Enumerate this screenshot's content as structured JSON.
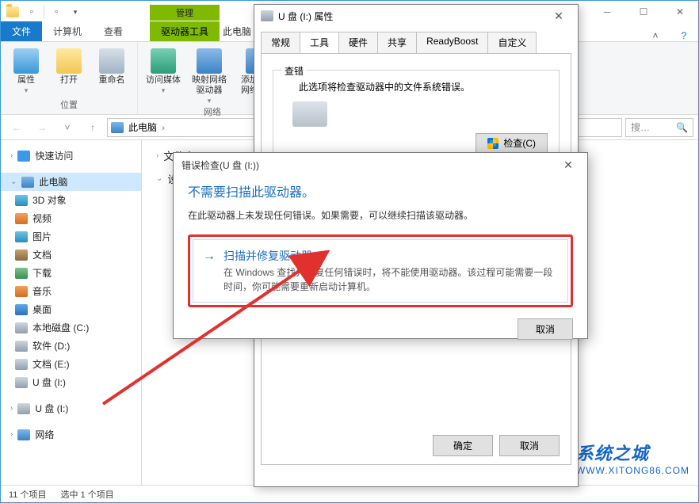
{
  "explorer": {
    "qat_dropdown": "▾",
    "context_group": "管理",
    "title": "此电脑",
    "tabs": {
      "file": "文件",
      "computer": "计算机",
      "view": "查看",
      "driveTools": "驱动器工具"
    },
    "ribbon": {
      "group_location": "位置",
      "group_network": "网络",
      "props": "属性",
      "open": "打开",
      "rename": "重命名",
      "media": "访问媒体",
      "mapnet": "映射网络\n驱动器",
      "addnet": "添加一个\n网络位置"
    },
    "address": {
      "crumb_root": "此电脑",
      "search_placeholder": "搜…"
    },
    "nav": {
      "quick": "快速访问",
      "pc": "此电脑",
      "obj3d": "3D 对象",
      "video": "视频",
      "pic": "图片",
      "doc": "文档",
      "dl": "下载",
      "music": "音乐",
      "desk": "桌面",
      "cdrive": "本地磁盘 (C:)",
      "ddrive": "软件 (D:)",
      "edrive": "文档 (E:)",
      "usb1": "U 盘 (I:)",
      "usb2": "U 盘 (I:)",
      "net": "网络"
    },
    "content": {
      "folders_sect": "文件夹",
      "folders_partial": "文件夹",
      "devices_sect": "设备和",
      "devices_partial": "设备和"
    },
    "status": {
      "count": "11 个项目",
      "selected": "选中 1 个项目"
    }
  },
  "propDialog": {
    "title": "U 盘 (I:) 属性",
    "tabs": {
      "general": "常规",
      "tools": "工具",
      "hardware": "硬件",
      "share": "共享",
      "readyboost": "ReadyBoost",
      "custom": "自定义"
    },
    "errcheck": {
      "group": "查错",
      "desc": "此选项将检查驱动器中的文件系统错误。",
      "button": "检查(C)"
    },
    "ok": "确定",
    "cancel": "取消"
  },
  "errDialog": {
    "title": "错误检查(U 盘 (I:))",
    "headline": "不需要扫描此驱动器。",
    "subtext": "在此驱动器上未发现任何错误。如果需要，可以继续扫描该驱动器。",
    "action_title": "扫描并修复驱动器",
    "action_desc": "在 Windows 查找并修复任何错误时，将不能使用驱动器。该过程可能需要一段时间，你可能需要重新启动计算机。",
    "cancel": "取消"
  },
  "watermark": {
    "cn": "系统之城",
    "url": "WWW.XITONG86.COM"
  }
}
